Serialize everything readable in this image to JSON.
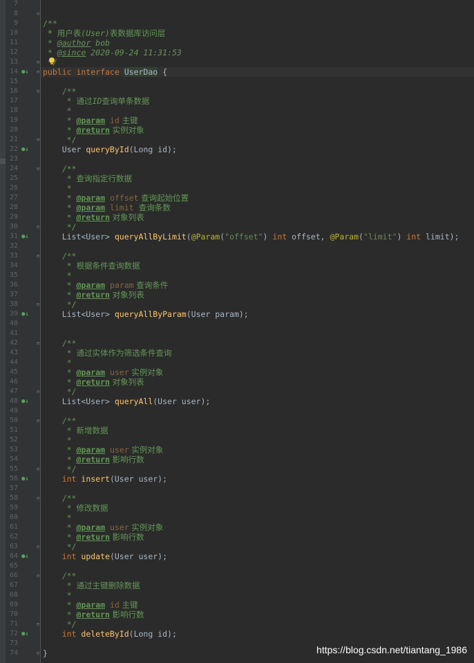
{
  "lines": {
    "l7": {
      "num": "7"
    },
    "l8": {
      "num": "8",
      "c1": "/**"
    },
    "l9": {
      "num": "9",
      "c1": " * ",
      "c2": "用户表",
      "c3": "(User)",
      "c4": "表数据库访问层"
    },
    "l10": {
      "num": "10",
      "c1": " *"
    },
    "l11": {
      "num": "11",
      "c1": " * ",
      "tag": "@author",
      "c2": " bob"
    },
    "l12": {
      "num": "12",
      "c1": " * ",
      "tag": "@since",
      "c2": " 2020-09-24 11:31:53"
    },
    "l13": {
      "num": "13",
      "c1": " */"
    },
    "l14": {
      "num": "14",
      "kw": "public interface ",
      "name": "UserDao",
      "rest": " {"
    },
    "l15": {
      "num": "15"
    },
    "l16": {
      "num": "16",
      "c1": "    /**"
    },
    "l17": {
      "num": "17",
      "c1": "     * ",
      "c2": "通过",
      "c3": "ID",
      "c4": "查询单条数据"
    },
    "l18": {
      "num": "18",
      "c1": "     *"
    },
    "l19": {
      "num": "19",
      "c1": "     * ",
      "tag": "@param",
      "p": " id",
      "c2": " 主键"
    },
    "l20": {
      "num": "20",
      "c1": "     * ",
      "tag": "@return",
      "c2": " 实例对象"
    },
    "l21": {
      "num": "21",
      "c1": "     */"
    },
    "l22": {
      "num": "22",
      "a": "    User ",
      "fn": "queryById",
      "b": "(Long id);"
    },
    "l23": {
      "num": "23"
    },
    "l24": {
      "num": "24",
      "c1": "    /**"
    },
    "l25": {
      "num": "25",
      "c1": "     * ",
      "c2": "查询指定行数据"
    },
    "l26": {
      "num": "26",
      "c1": "     *"
    },
    "l27": {
      "num": "27",
      "c1": "     * ",
      "tag": "@param",
      "p": " offset",
      "c2": " 查询起始位置"
    },
    "l28": {
      "num": "28",
      "c1": "     * ",
      "tag": "@param",
      "p": " limit",
      "c2": "  查询条数"
    },
    "l29": {
      "num": "29",
      "c1": "     * ",
      "tag": "@return",
      "c2": " 对象列表"
    },
    "l30": {
      "num": "30",
      "c1": "     */"
    },
    "l31": {
      "num": "31",
      "a": "    List<User> ",
      "fn": "queryAllByLimit",
      "b": "(",
      "an1": "@Param",
      "b2": "(",
      "s1": "\"offset\"",
      "b3": ") ",
      "kw1": "int",
      "b4": " offset, ",
      "an2": "@Param",
      "b5": "(",
      "s2": "\"limit\"",
      "b6": ") ",
      "kw2": "int",
      "b7": " limit);"
    },
    "l32": {
      "num": "32"
    },
    "l33": {
      "num": "33",
      "c1": "    /**"
    },
    "l34": {
      "num": "34",
      "c1": "     * ",
      "c2": "根据条件查询数据"
    },
    "l35": {
      "num": "35",
      "c1": "     *"
    },
    "l36": {
      "num": "36",
      "c1": "     * ",
      "tag": "@param",
      "p": " param",
      "c2": " 查询条件"
    },
    "l37": {
      "num": "37",
      "c1": "     * ",
      "tag": "@return",
      "c2": " 对象列表"
    },
    "l38": {
      "num": "38",
      "c1": "     */"
    },
    "l39": {
      "num": "39",
      "a": "    List<User> ",
      "fn": "queryAllByParam",
      "b": "(User param);"
    },
    "l40": {
      "num": "40"
    },
    "l41": {
      "num": "41"
    },
    "l42": {
      "num": "42",
      "c1": "    /**"
    },
    "l43": {
      "num": "43",
      "c1": "     * ",
      "c2": "通过实体作为筛选条件查询"
    },
    "l44": {
      "num": "44",
      "c1": "     *"
    },
    "l45": {
      "num": "45",
      "c1": "     * ",
      "tag": "@param",
      "p": " user",
      "c2": " 实例对象"
    },
    "l46": {
      "num": "46",
      "c1": "     * ",
      "tag": "@return",
      "c2": " 对象列表"
    },
    "l47": {
      "num": "47",
      "c1": "     */"
    },
    "l48": {
      "num": "48",
      "a": "    List<User> ",
      "fn": "queryAll",
      "b": "(User user);"
    },
    "l49": {
      "num": "49"
    },
    "l50": {
      "num": "50",
      "c1": "    /**"
    },
    "l51": {
      "num": "51",
      "c1": "     * ",
      "c2": "新增数据"
    },
    "l52": {
      "num": "52",
      "c1": "     *"
    },
    "l53": {
      "num": "53",
      "c1": "     * ",
      "tag": "@param",
      "p": " user",
      "c2": " 实例对象"
    },
    "l54": {
      "num": "54",
      "c1": "     * ",
      "tag": "@return",
      "c2": " 影响行数"
    },
    "l55": {
      "num": "55",
      "c1": "     */"
    },
    "l56": {
      "num": "56",
      "kw": "    int ",
      "fn": "insert",
      "b": "(User user);"
    },
    "l57": {
      "num": "57"
    },
    "l58": {
      "num": "58",
      "c1": "    /**"
    },
    "l59": {
      "num": "59",
      "c1": "     * ",
      "c2": "修改数据"
    },
    "l60": {
      "num": "60",
      "c1": "     *"
    },
    "l61": {
      "num": "61",
      "c1": "     * ",
      "tag": "@param",
      "p": " user",
      "c2": " 实例对象"
    },
    "l62": {
      "num": "62",
      "c1": "     * ",
      "tag": "@return",
      "c2": " 影响行数"
    },
    "l63": {
      "num": "63",
      "c1": "     */"
    },
    "l64": {
      "num": "64",
      "kw": "    int ",
      "fn": "update",
      "b": "(User user);"
    },
    "l65": {
      "num": "65"
    },
    "l66": {
      "num": "66",
      "c1": "    /**"
    },
    "l67": {
      "num": "67",
      "c1": "     * ",
      "c2": "通过主键删除数据"
    },
    "l68": {
      "num": "68",
      "c1": "     *"
    },
    "l69": {
      "num": "69",
      "c1": "     * ",
      "tag": "@param",
      "p": " id",
      "c2": " 主键"
    },
    "l70": {
      "num": "70",
      "c1": "     * ",
      "tag": "@return",
      "c2": " 影响行数"
    },
    "l71": {
      "num": "71",
      "c1": "     */"
    },
    "l72": {
      "num": "72",
      "kw": "    int ",
      "fn": "deleteById",
      "b": "(Long id);"
    },
    "l73": {
      "num": "73"
    },
    "l74": {
      "num": "74",
      "rest": "}"
    }
  },
  "watermark": "https://blog.csdn.net/tiantang_1986",
  "colors": {
    "background": "#2b2b2b",
    "gutter": "#313335",
    "comment": "#629755",
    "keyword": "#cc7832",
    "method": "#ffc66d",
    "string": "#6a8759",
    "annotation": "#bbb529",
    "text": "#a9b7c6"
  }
}
